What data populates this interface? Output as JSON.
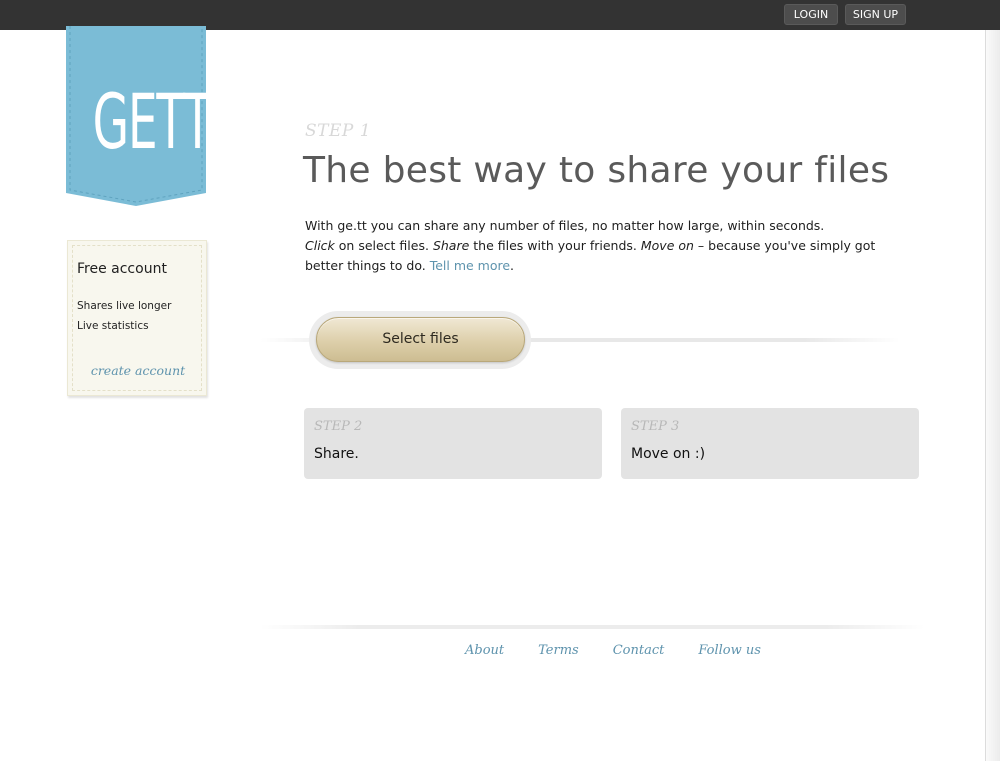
{
  "header": {
    "login_label": "LOGIN",
    "signup_label": "SIGN UP"
  },
  "logo": {
    "text": "GETT",
    "color": "#7bbcd6"
  },
  "account_card": {
    "title": "Free account",
    "features": [
      "Shares live longer",
      "Live statistics"
    ],
    "create_link": "create account"
  },
  "step1": {
    "label": "STEP 1",
    "headline": "The best way to share your files",
    "intro_line1": "With ge.tt you can share any number of files, no matter how large, within seconds.",
    "click_word": "Click",
    "click_rest": " on select files. ",
    "share_word": "Share",
    "share_rest": " the files with your friends. ",
    "moveon_word": "Move on",
    "moveon_rest": " – because you've simply got better things to do. ",
    "tell_more": "Tell me more",
    "period": "."
  },
  "select_button": {
    "label": "Select files"
  },
  "step2": {
    "label": "STEP 2",
    "text": "Share."
  },
  "step3": {
    "label": "STEP 3",
    "text": "Move on :)"
  },
  "footer": {
    "links": [
      "About",
      "Terms",
      "Contact",
      "Follow us"
    ]
  },
  "colors": {
    "topbar": "#333333",
    "link": "#5e93ad",
    "step_box": "#e3e3e3",
    "button_gold": "#ddcfaa"
  }
}
